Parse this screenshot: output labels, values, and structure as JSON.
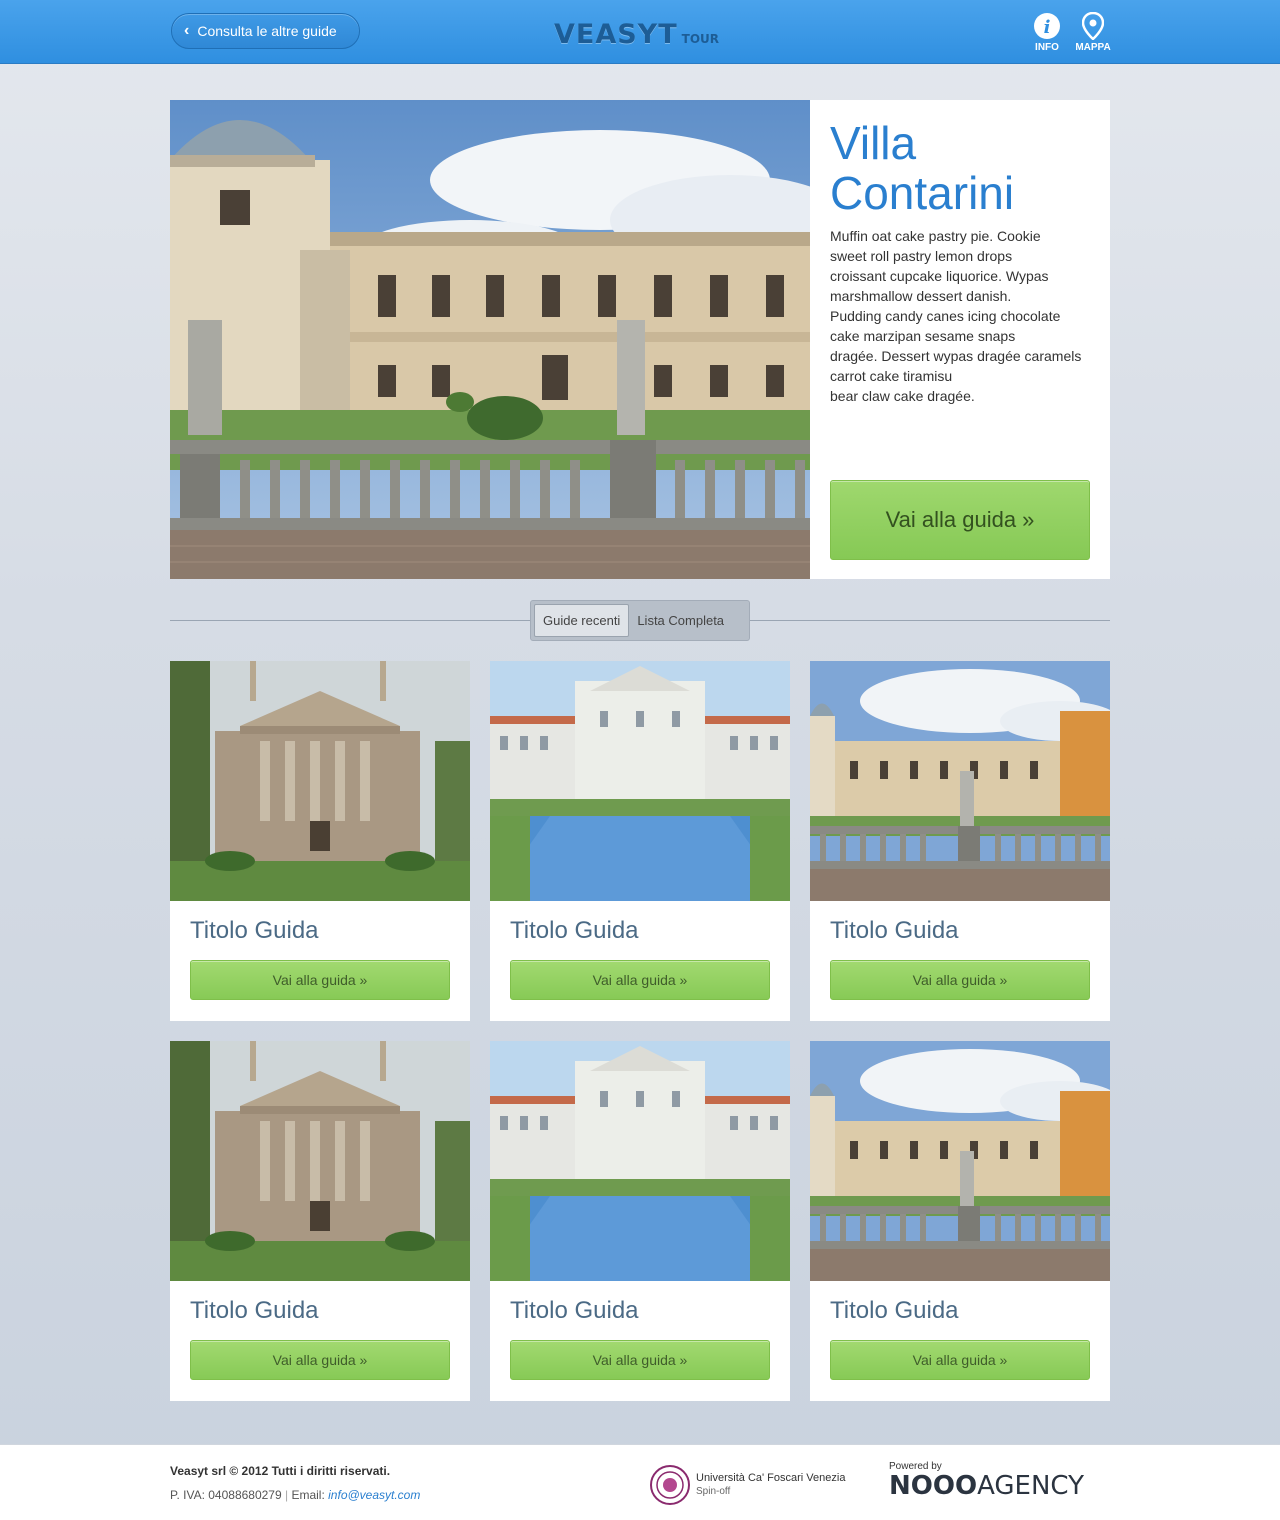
{
  "header": {
    "back_label": "Consulta le altre guide",
    "logo_main": "VEASYT",
    "logo_sub": "TOUR",
    "info_label": "INFO",
    "map_label": "MAPPA"
  },
  "hero": {
    "title": "Villa\nContarini",
    "description": "Muffin oat cake pastry pie. Cookie\nsweet roll pastry lemon drops\ncroissant cupcake liquorice. Wypas\nmarshmallow dessert danish.\nPudding candy canes icing chocolate\ncake marzipan sesame snaps\ndragée. Dessert wypas dragée caramels\ncarrot cake tiramisu\nbear claw cake dragée.",
    "button": "Vai alla guida »"
  },
  "tabs": [
    {
      "label": "Guide recenti",
      "active": true
    },
    {
      "label": "Lista Completa",
      "active": false
    }
  ],
  "cards": [
    {
      "title": "Titolo Guida",
      "button": "Vai alla guida »",
      "image": "villa-foscari"
    },
    {
      "title": "Titolo Guida",
      "button": "Vai alla guida »",
      "image": "villa-pisani"
    },
    {
      "title": "Titolo Guida",
      "button": "Vai alla guida »",
      "image": "villa-contarini"
    },
    {
      "title": "Titolo Guida",
      "button": "Vai alla guida »",
      "image": "villa-foscari"
    },
    {
      "title": "Titolo Guida",
      "button": "Vai alla guida »",
      "image": "villa-pisani"
    },
    {
      "title": "Titolo Guida",
      "button": "Vai alla guida »",
      "image": "villa-contarini"
    }
  ],
  "footer": {
    "copyright": "Veasyt srl © 2012 Tutti i diritti riservati.",
    "piva": "P. IVA: 04088680279",
    "email_label": "Email:",
    "email": "info@veasyt.com",
    "university": "Università Ca' Foscari Venezia",
    "spin_off": "Spin-off",
    "powered_by": "Powered by",
    "agency_bold": "NOOO",
    "agency_rest": "AGENCY"
  }
}
